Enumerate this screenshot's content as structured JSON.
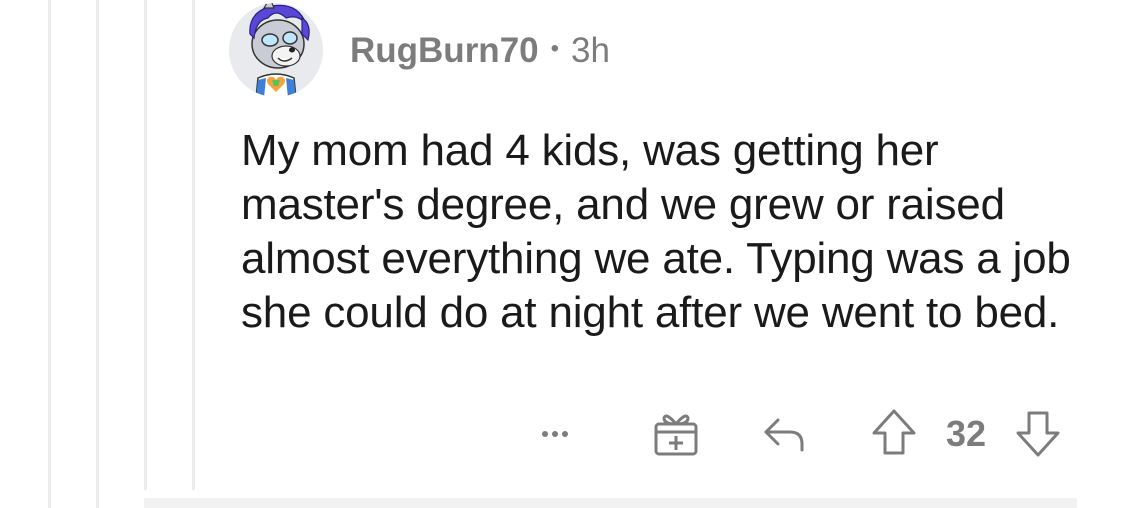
{
  "comment": {
    "username": "RugBurn70",
    "separator": "•",
    "time": "3h",
    "body": "My mom had 4 kids, was getting her master's degree, and we grew or raised almost everything we ate. Typing was a job she could do at night after we went to bed.",
    "score": "32"
  },
  "icons": {
    "more": "more-options-icon",
    "award": "gift-award-icon",
    "reply": "reply-arrow-icon",
    "upvote": "upvote-arrow-icon",
    "downvote": "downvote-arrow-icon",
    "avatar": "snoo-avatar-icon"
  },
  "colors": {
    "text": "#1a1a1b",
    "meta": "#7c7c7c",
    "thread_line": "#ebebeb",
    "avatar_bg": "#e9eaed",
    "avatar_hair": "#5b47d6"
  }
}
